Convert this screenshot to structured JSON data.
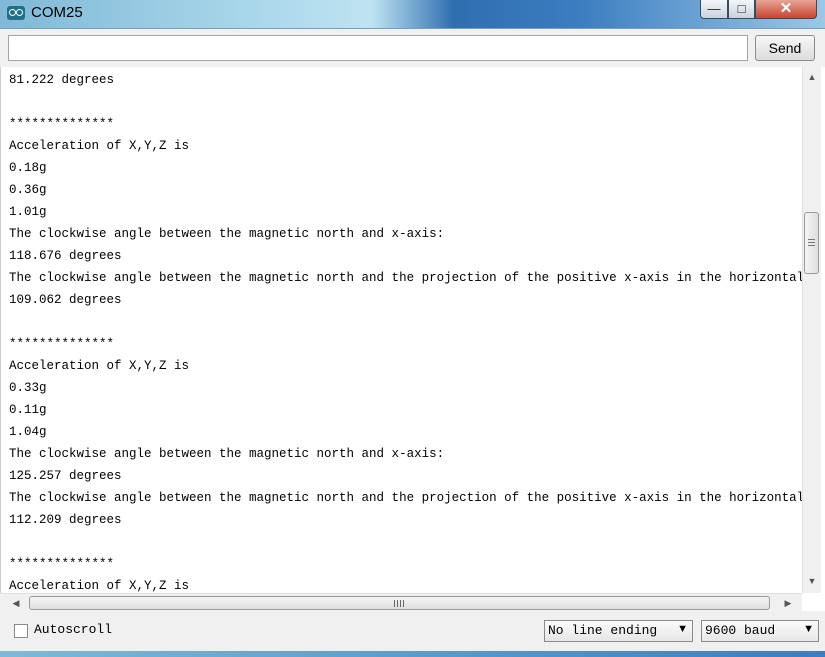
{
  "window": {
    "title": "COM25",
    "minimize_glyph": "—",
    "maximize_glyph": "□",
    "close_glyph": "✕"
  },
  "toolbar": {
    "input_value": "",
    "send_label": "Send"
  },
  "output": {
    "lines": [
      "81.222 degrees",
      "",
      "**************",
      "Acceleration of X,Y,Z is",
      "0.18g",
      "0.36g",
      "1.01g",
      "The clockwise angle between the magnetic north and x-axis:",
      "118.676 degrees",
      "The clockwise angle between the magnetic north and the projection of the positive x-axis in the horizontal plane:",
      "109.062 degrees",
      "",
      "**************",
      "Acceleration of X,Y,Z is",
      "0.33g",
      "0.11g",
      "1.04g",
      "The clockwise angle between the magnetic north and x-axis:",
      "125.257 degrees",
      "The clockwise angle between the magnetic north and the projection of the positive x-axis in the horizontal plane:",
      "112.209 degrees",
      "",
      "**************",
      "Acceleration of X,Y,Z is"
    ]
  },
  "scrollbars": {
    "up_glyph": "▲",
    "down_glyph": "▼",
    "left_glyph": "◀",
    "right_glyph": "▶"
  },
  "footer": {
    "autoscroll_label": "Autoscroll",
    "autoscroll_checked": false,
    "line_ending_value": "No line ending",
    "baud_value": "9600 baud",
    "dropdown_glyph": "▼"
  }
}
